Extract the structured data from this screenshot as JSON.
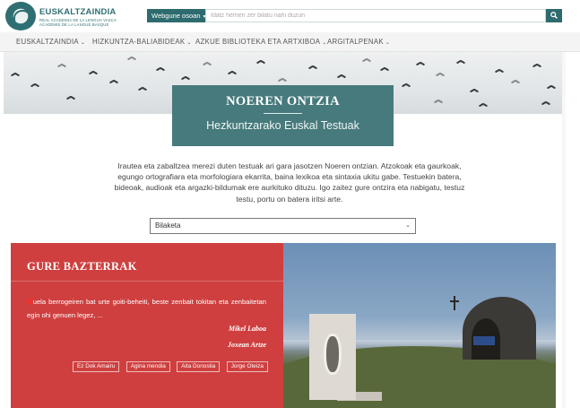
{
  "header": {
    "brand": "EUSKALTZAINDIA",
    "brand_sub1": "REAL ACADEMIA DE LA LENGUA VASCA",
    "brand_sub2": "ACADÉMIE DE LA LANGUE BASQUE",
    "search_scope": "Webgune osoan",
    "search_placeholder": "Idatz hemen zer bilatu nahi duzun",
    "search_icon": "search-icon"
  },
  "nav": {
    "items": [
      {
        "label": "EUSKALTZAINDIA"
      },
      {
        "label": "HIZKUNTZA-BALIABIDEAK"
      },
      {
        "label": "AZKUE BIBLIOTEKA ETA ARTXIBOA"
      },
      {
        "label": "ARGITALPENAK"
      }
    ]
  },
  "hero": {
    "title": "NOEREN ONTZIA",
    "subtitle": "Hezkuntzarako Euskal Testuak"
  },
  "intro": "Irautea eta zabaltzea merezi duten testuak ari gara jasotzen Noeren ontzian. Atzokoak eta gaurkoak, egungo ortografiara eta morfologiara ekarrita, baina lexikoa eta sintaxia ukitu gabe. Testuekin batera, bideoak, audioak eta argazki-bildumak ere aurkituko dituzu. Igo zaitez gure ontzira eta nabigatu, testuz testu, portu on batera iritsi arte.",
  "select": {
    "value": "Bilaketa"
  },
  "feature": {
    "title": "GURE BAZTERRAK",
    "quote_initial": "d",
    "quote_rest": "uela berrogeiren bat urte goiti-beheiti, beste zenbait tokitan eta zenbaitetan egin ohi genuen legez, ...",
    "author1": "Mikel Laboa",
    "author2": "Joxean Artze",
    "tags": [
      "Ez Dok Amairu",
      "Agina mendia",
      "Aita Donostia",
      "Jorge Oteiza"
    ]
  },
  "colors": {
    "teal": "#2d6b6e",
    "title_box": "#467a7d",
    "feature_red": "#cf3f3f"
  }
}
